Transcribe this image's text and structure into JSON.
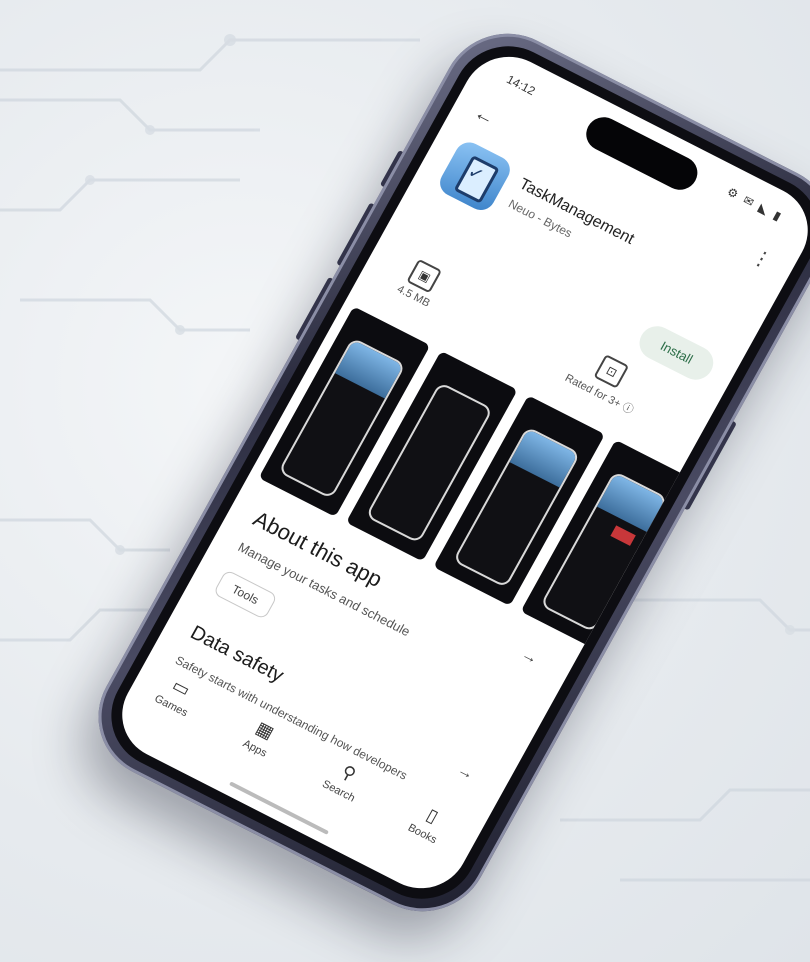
{
  "status_bar": {
    "time": "14:12",
    "icons": "⚙ ✉ ◣ ▮"
  },
  "header": {
    "back_icon": "arrow-left-icon",
    "more_icon": "more-vertical-icon"
  },
  "app": {
    "name": "TaskManagement",
    "subtitle": "Neuo - Bytes",
    "install_label": "Install"
  },
  "stats": [
    {
      "symbol": "▣",
      "label": "4.5 MB"
    },
    {
      "symbol": "⊡",
      "label": "Rated for 3+ ⓘ"
    }
  ],
  "screenshots": [
    {
      "caption": ""
    },
    {
      "caption": ""
    },
    {
      "caption": ""
    },
    {
      "caption": ""
    }
  ],
  "about": {
    "title": "About this app",
    "description": "Manage your tasks and schedule",
    "chip": "Tools"
  },
  "data_safety": {
    "title": "Data safety",
    "description": "Safety starts with understanding how developers"
  },
  "bottom_nav": [
    {
      "icon": "▭",
      "label": "Games"
    },
    {
      "icon": "▦",
      "label": "Apps"
    },
    {
      "icon": "⚲",
      "label": "Search"
    },
    {
      "icon": "▯",
      "label": "Books"
    }
  ],
  "colors": {
    "install_bg": "#e8f0ea",
    "install_text": "#2c6e48",
    "frame": "#3a3b52",
    "background": "#e6eaee"
  }
}
